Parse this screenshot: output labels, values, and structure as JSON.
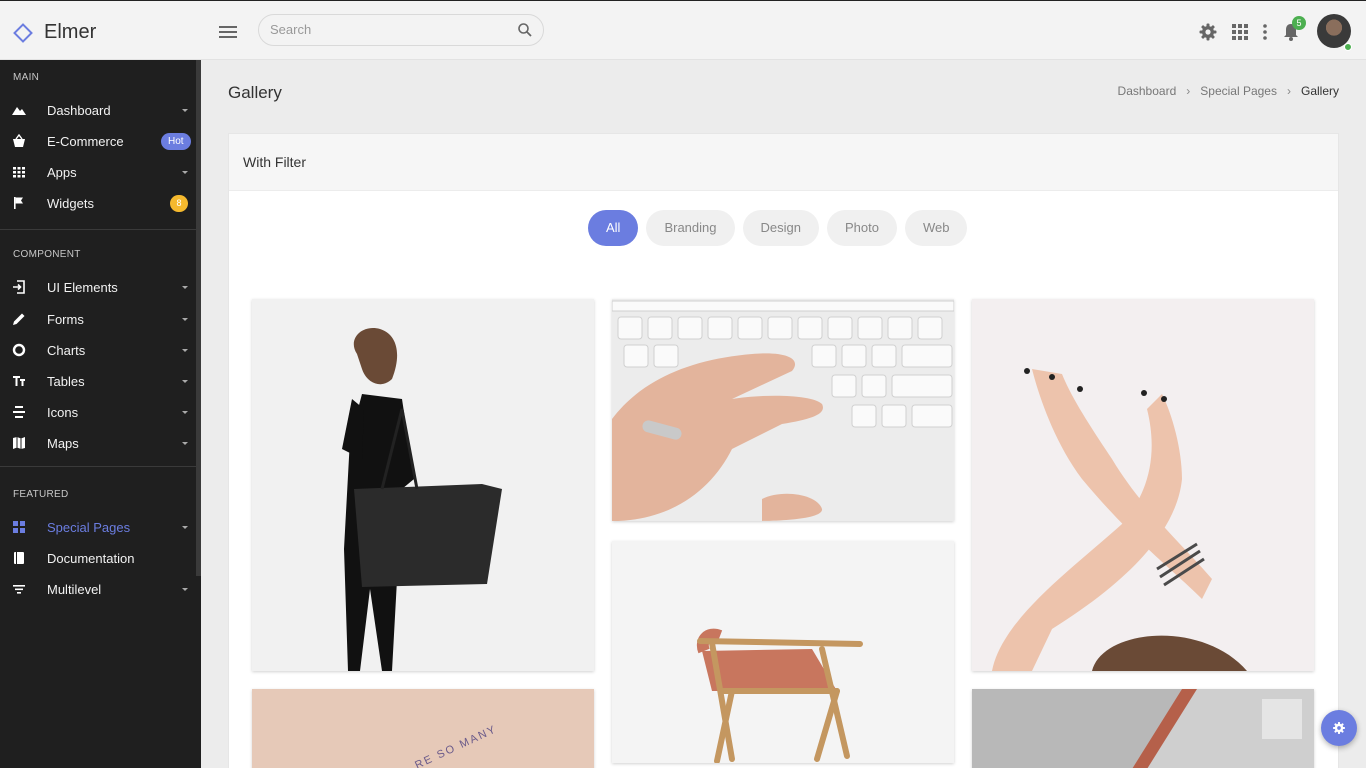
{
  "app": {
    "name": "Elmer"
  },
  "search": {
    "placeholder": "Search"
  },
  "header": {
    "notifications_count": "5"
  },
  "sidebar": {
    "sections": [
      {
        "title": "MAIN"
      },
      {
        "title": "COMPONENT"
      },
      {
        "title": "FEATURED"
      }
    ],
    "items": [
      {
        "label": "Dashboard",
        "icon": "mountain-icon"
      },
      {
        "label": "E-Commerce",
        "icon": "basket-icon",
        "badge": "Hot"
      },
      {
        "label": "Apps",
        "icon": "grid-icon"
      },
      {
        "label": "Widgets",
        "icon": "flag-icon",
        "badge": "8"
      },
      {
        "label": "UI Elements",
        "icon": "login-icon"
      },
      {
        "label": "Forms",
        "icon": "pencil-icon"
      },
      {
        "label": "Charts",
        "icon": "donut-chart-icon"
      },
      {
        "label": "Tables",
        "icon": "text-height-icon"
      },
      {
        "label": "Icons",
        "icon": "settings-dots-icon"
      },
      {
        "label": "Maps",
        "icon": "map-icon"
      },
      {
        "label": "Special Pages",
        "icon": "pages-icon",
        "active": true
      },
      {
        "label": "Documentation",
        "icon": "book-icon"
      },
      {
        "label": "Multilevel",
        "icon": "filter-list-icon"
      }
    ]
  },
  "page": {
    "title": "Gallery",
    "breadcrumb": [
      "Dashboard",
      "Special Pages",
      "Gallery"
    ]
  },
  "card": {
    "title": "With Filter",
    "filters": [
      "All",
      "Branding",
      "Design",
      "Photo",
      "Web"
    ],
    "active_filter": "All"
  },
  "colors": {
    "accent": "#6b7de0",
    "sidebar_bg": "#1f1f1f",
    "warning": "#f5b92e",
    "success": "#4caf50"
  }
}
